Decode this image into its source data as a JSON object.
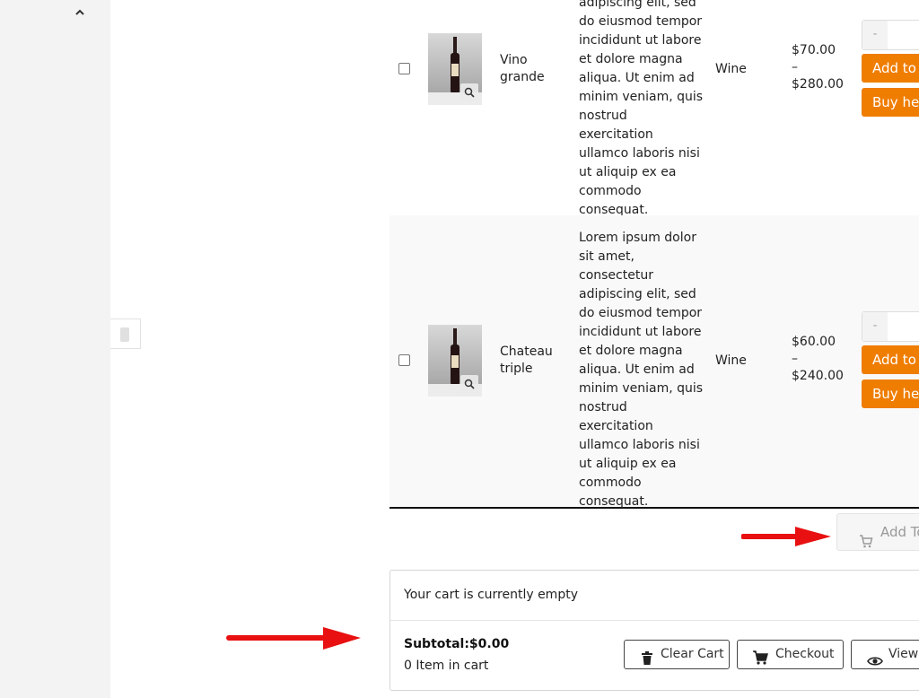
{
  "colors": {
    "accent": "#ef7d00",
    "arrow": "#e81010"
  },
  "sidebar": {
    "collapse_icon": "chevron-up-icon"
  },
  "products": [
    {
      "name": "Vino grande",
      "description_visible": "adipiscing elit, sed do eiusmod tempor incididunt ut labore et dolore magna aliqua. Ut enim ad minim veniam, quis nostrud exercitation ullamco laboris nisi ut aliquip ex ea commodo consequat.",
      "category": "Wine",
      "price_low": "$70.00",
      "price_dash": "–",
      "price_high": "$280.00",
      "qty_minus": "-",
      "add_label": "Add to c",
      "buy_label": "Buy here"
    },
    {
      "name": "Chateau triple",
      "description_visible": "Lorem ipsum dolor sit amet, consectetur adipiscing elit, sed do eiusmod tempor incididunt ut labore et dolore magna aliqua. Ut enim ad minim veniam, quis nostrud exercitation ullamco laboris nisi ut aliquip ex ea commodo consequat.",
      "category": "Wine",
      "price_low": "$60.00",
      "price_dash": "–",
      "price_high": "$240.00",
      "qty_minus": "-",
      "add_label": "Add to c",
      "buy_label": "Buy here"
    }
  ],
  "add_to_cart_bulk": {
    "label": "Add To",
    "icon": "cart-icon"
  },
  "minicart": {
    "empty_text": "Your cart is currently empty",
    "subtotal": "Subtotal:$0.00",
    "items_text": "0 Item in cart",
    "clear_label": "Clear Cart",
    "checkout_label": "Checkout",
    "view_label": "View"
  }
}
